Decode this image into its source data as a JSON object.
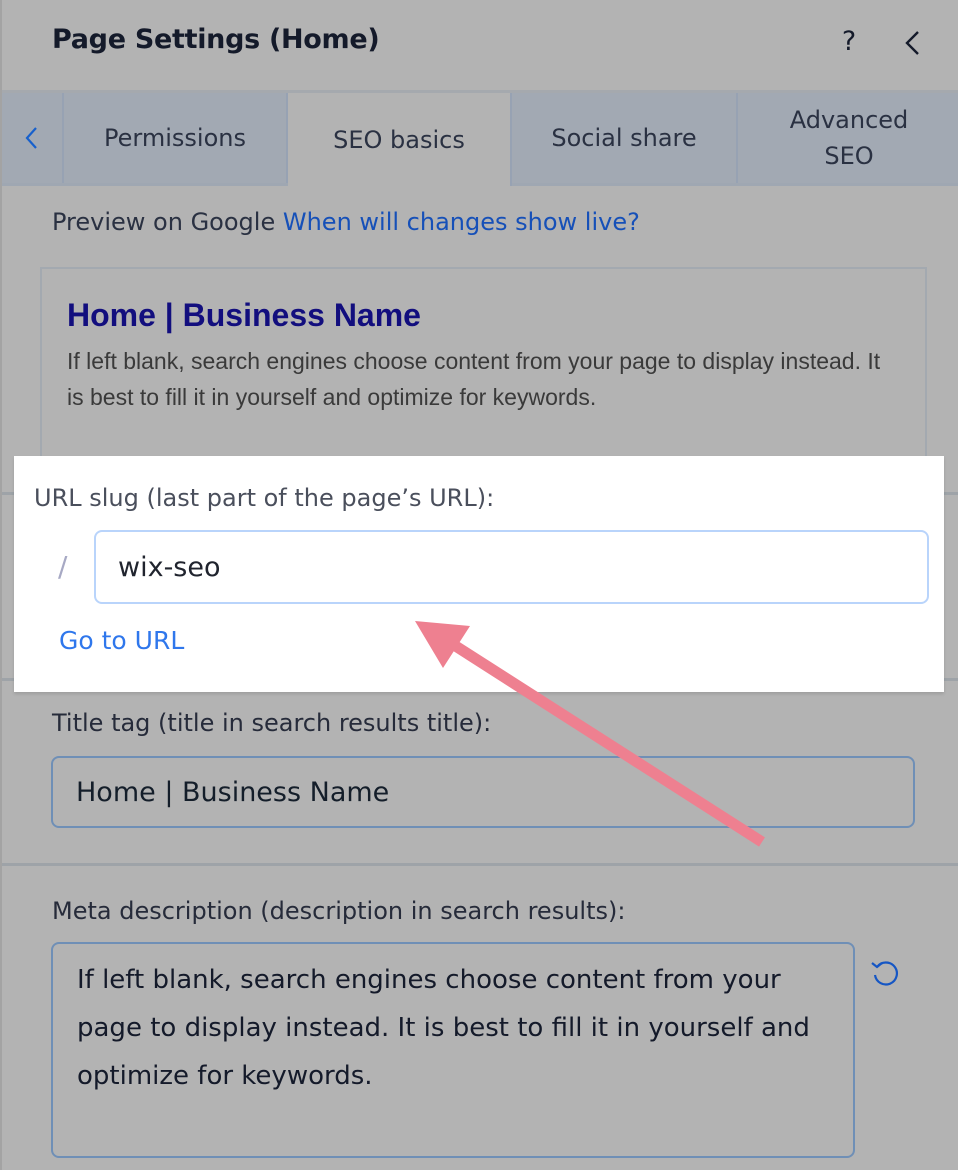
{
  "header": {
    "title": "Page Settings (Home)",
    "help_label": "?",
    "help_icon": "question-mark-icon",
    "collapse_icon": "chevron-left-icon"
  },
  "tabs": {
    "back_icon": "chevron-left-icon",
    "items": [
      {
        "label": "Permissions",
        "active": false
      },
      {
        "label": "SEO basics",
        "active": true
      },
      {
        "label": "Social share",
        "active": false
      },
      {
        "label": "Advanced SEO",
        "active": false
      }
    ]
  },
  "preview": {
    "label": "Preview on Google",
    "link": "When will changes show live?",
    "title": "Home | Business Name",
    "description": "If left blank, search engines choose content from your page to display instead. It is best to fill it in yourself and optimize for keywords."
  },
  "url_slug": {
    "label": "URL slug (last part of the page’s URL):",
    "prefix": "/",
    "value": "wix-seo",
    "go_link": "Go to URL"
  },
  "title_tag": {
    "label": "Title tag (title in search results title):",
    "value": "Home | Business Name"
  },
  "meta_description": {
    "label": "Meta description (description in search results):",
    "value": "If left blank, search engines choose content from your page to display instead. It is best to fill it in yourself and optimize for keywords.",
    "reset_icon": "reset-icon"
  },
  "colors": {
    "link_blue": "#1650b8",
    "go_url_blue": "#2f77ec",
    "annotation_arrow": "#ee8090",
    "preview_title": "#120e7e"
  }
}
